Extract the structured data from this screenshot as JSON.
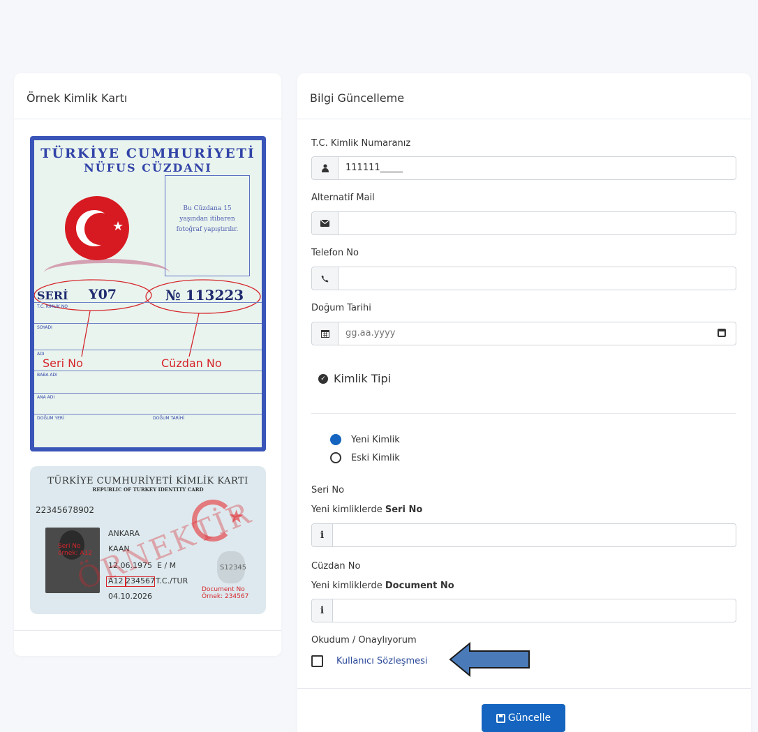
{
  "left": {
    "title": "Örnek Kimlik Kartı",
    "old_card": {
      "title1": "TÜRKİYE CUMHURİYETİ",
      "title2": "NÜFUS CÜZDANI",
      "photo_text1": "Bu Cüzdana 15",
      "photo_text2": "yaşından itibaren",
      "photo_text3": "fotoğraf yapıştırılır.",
      "seri_label": "SERİ",
      "seri_value": "Y07",
      "no_value": "№ 113223",
      "row1": "T.C. KİMLİK NO",
      "row2": "SOYADI",
      "row3": "ADI",
      "row4": "BABA ADI",
      "row5": "ANA ADI",
      "row6a": "DOĞUM YERİ",
      "row6b": "DOĞUM TARİHİ",
      "annot_seri": "Seri No",
      "annot_cuzdan": "Cüzdan No"
    },
    "new_card": {
      "title": "TÜRKİYE CUMHURİYETİ KİMLİK KARTI",
      "subtitle": "REPUBLIC OF TURKEY IDENTITY CARD",
      "tc_no": "22345678902",
      "surname": "ANKARA",
      "name": "KAAN",
      "birth": "12.06.1975",
      "gender": "E / M",
      "nationality": "T.C./TUR",
      "doc_no": "A12 234567",
      "valid": "04.10.2026",
      "hologram": "S12345",
      "watermark": "ÖRNEKTİR",
      "annot_seri1": "Seri No",
      "annot_seri2": "örnek: A12",
      "annot_doc1": "Document No",
      "annot_doc2": "Örnek: 234567"
    }
  },
  "form": {
    "title": "Bilgi Güncelleme",
    "tc_label": "T.C. Kimlik Numaranız",
    "tc_value": "111111_____",
    "alt_mail_label": "Alternatif Mail",
    "alt_mail_value": "",
    "phone_label": "Telefon No",
    "phone_value": "",
    "birth_label": "Doğum Tarihi",
    "birth_placeholder": "gg.aa.yyyy",
    "kimlik_tipi": "Kimlik Tipi",
    "radio_new": "Yeni Kimlik",
    "radio_old": "Eski Kimlik",
    "seri_label": "Seri No",
    "seri_hint_prefix": "Yeni kimliklerde ",
    "seri_hint_bold": "Seri No",
    "seri_value": "",
    "cuzdan_label": "Cüzdan No",
    "cuzdan_hint_prefix": "Yeni kimliklerde ",
    "cuzdan_hint_bold": "Document No",
    "cuzdan_value": "",
    "consent_label": "Okudum / Onaylıyorum",
    "agreement_link": "Kullanıcı Sözleşmesi",
    "submit": "Güncelle"
  },
  "colors": {
    "primary": "#1565c0",
    "arrow_fill": "#4a7ab8",
    "annotation_red": "#d6262c"
  }
}
